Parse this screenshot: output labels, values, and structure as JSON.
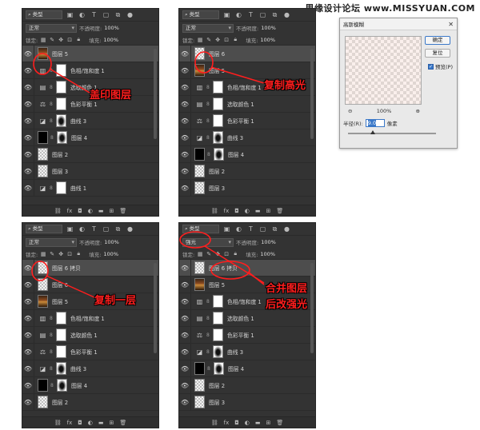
{
  "watermark": "思缘设计论坛 www.MISSYUAN.COM",
  "common": {
    "kind_label": "类型",
    "opacity_label": "不透明度:",
    "opacity_value": "100%",
    "lock_label": "锁定:",
    "fill_label": "填充:",
    "fill_value": "100%",
    "icons": [
      "image-filter-icon",
      "adjustment-filter-icon",
      "type-filter-icon",
      "shape-filter-icon",
      "smart-object-filter-icon",
      "toggle-filter-icon"
    ]
  },
  "panels": [
    {
      "blend_mode": "正常",
      "layers": [
        {
          "name": "图层 5",
          "thumb": "portrait",
          "selected": true
        },
        {
          "name": "色相/饱和度 1",
          "adjust": "hue-saturation-icon",
          "mask": "white"
        },
        {
          "name": "选取颜色 1",
          "adjust": "selective-color-icon",
          "mask": "white"
        },
        {
          "name": "色彩平衡 1",
          "adjust": "color-balance-icon",
          "mask": "white"
        },
        {
          "name": "曲线 3",
          "adjust": "curves-icon",
          "mask": "mask"
        },
        {
          "name": "图层 4",
          "thumb": "black",
          "mask": "mask"
        },
        {
          "name": "图层 2",
          "thumb": "checker"
        },
        {
          "name": "图层 3",
          "thumb": "checker"
        },
        {
          "name": "曲线 1",
          "adjust": "curves-icon",
          "mask": "white"
        }
      ],
      "callout": "盖印图层"
    },
    {
      "blend_mode": "正常",
      "layers": [
        {
          "name": "图层 6",
          "thumb": "checker",
          "selected": true
        },
        {
          "name": "图层 5",
          "thumb": "portrait"
        },
        {
          "name": "色相/饱和度 1",
          "adjust": "hue-saturation-icon",
          "mask": "white"
        },
        {
          "name": "选取颜色 1",
          "adjust": "selective-color-icon",
          "mask": "white"
        },
        {
          "name": "色彩平衡 1",
          "adjust": "color-balance-icon",
          "mask": "white"
        },
        {
          "name": "曲线 3",
          "adjust": "curves-icon",
          "mask": "mask"
        },
        {
          "name": "图层 4",
          "thumb": "black",
          "mask": "mask"
        },
        {
          "name": "图层 2",
          "thumb": "checker"
        },
        {
          "name": "图层 3",
          "thumb": "checker"
        }
      ],
      "callout": "复制高光"
    },
    {
      "blend_mode": "正常",
      "layers": [
        {
          "name": "图层 6 拷贝",
          "thumb": "checker",
          "selected": true
        },
        {
          "name": "图层 6",
          "thumb": "checker"
        },
        {
          "name": "图层 5",
          "thumb": "portrait"
        },
        {
          "name": "色相/饱和度 1",
          "adjust": "hue-saturation-icon",
          "mask": "white"
        },
        {
          "name": "选取颜色 1",
          "adjust": "selective-color-icon",
          "mask": "white"
        },
        {
          "name": "色彩平衡 1",
          "adjust": "color-balance-icon",
          "mask": "white"
        },
        {
          "name": "曲线 3",
          "adjust": "curves-icon",
          "mask": "mask"
        },
        {
          "name": "图层 4",
          "thumb": "black",
          "mask": "mask"
        },
        {
          "name": "图层 2",
          "thumb": "checker"
        }
      ],
      "callout": "复制一层"
    },
    {
      "blend_mode": "强光",
      "layers": [
        {
          "name": "图层 6 拷贝",
          "thumb": "checker",
          "selected": true
        },
        {
          "name": "图层 5",
          "thumb": "portrait"
        },
        {
          "name": "色相/饱和度 1",
          "adjust": "hue-saturation-icon",
          "mask": "white"
        },
        {
          "name": "选取颜色 1",
          "adjust": "selective-color-icon",
          "mask": "white"
        },
        {
          "name": "色彩平衡 1",
          "adjust": "color-balance-icon",
          "mask": "white"
        },
        {
          "name": "曲线 3",
          "adjust": "curves-icon",
          "mask": "mask"
        },
        {
          "name": "图层 4",
          "thumb": "black",
          "mask": "mask"
        },
        {
          "name": "图层 2",
          "thumb": "checker"
        },
        {
          "name": "图层 3",
          "thumb": "checker"
        }
      ],
      "callout": "合并图层",
      "callout2": "后改强光"
    }
  ],
  "dialog": {
    "title": "高斯模糊",
    "ok": "确定",
    "reset": "复位",
    "preview": "预览(P)",
    "zoom": "100%",
    "radius_label": "半径(R):",
    "radius_value": "9.0",
    "unit": "像素"
  },
  "colors": {
    "accent": "#ff1e1e",
    "panel": "#333333",
    "selected": "#4d4d4d"
  }
}
